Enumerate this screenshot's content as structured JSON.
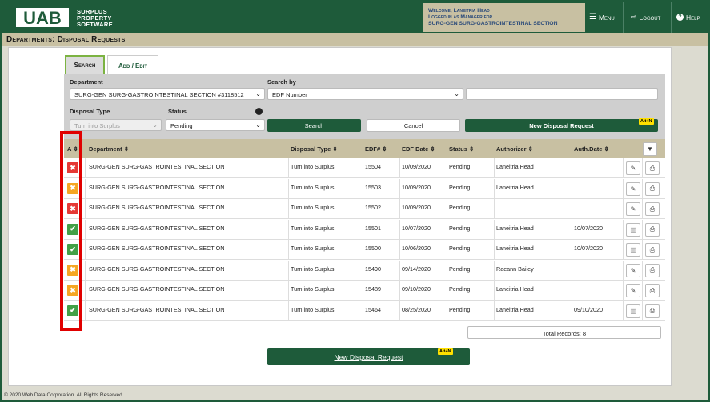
{
  "header": {
    "logo_text": "UAB",
    "app_name_lines": [
      "Surplus",
      "Property",
      "Software"
    ],
    "welcome_lines": [
      "Welcome, Laneitria Head",
      "Logged in as Manager for",
      "SURG-GEN SURG-GASTROINTESTINAL SECTION"
    ],
    "menu_label": "Menu",
    "logout_label": "Logout",
    "help_label": "Help"
  },
  "page_title": "Departments: Disposal Requests",
  "tabs": [
    {
      "label": "Search",
      "active": true
    },
    {
      "label": "Add / Edit",
      "active": false
    }
  ],
  "search": {
    "department_label": "Department",
    "department_value": "SURG-GEN SURG-GASTROINTESTINAL SECTION #3118512",
    "search_by_label": "Search by",
    "search_by_value": "EDF Number",
    "search_text_value": "",
    "disposal_type_label": "Disposal Type",
    "disposal_type_value": "Turn into Surplus",
    "status_label": "Status",
    "status_value": "Pending",
    "search_button": "Search",
    "cancel_button": "Cancel",
    "new_request_button": "New Disposal Request",
    "shortcut": "Alt+N"
  },
  "table": {
    "columns": [
      "A",
      "Department",
      "Disposal Type",
      "EDF#",
      "EDF Date",
      "Status",
      "Authorizer",
      "Auth.Date"
    ],
    "rows": [
      {
        "status_icon": "x",
        "color": "#e53935",
        "department": "SURG-GEN SURG-GASTROINTESTINAL SECTION",
        "type": "Turn into Surplus",
        "edf": "15504",
        "edf_date": "10/09/2020",
        "status": "Pending",
        "authorizer": "Laneitria Head",
        "auth_date": "",
        "action": "pencil"
      },
      {
        "status_icon": "x",
        "color": "#f5a623",
        "department": "SURG-GEN SURG-GASTROINTESTINAL SECTION",
        "type": "Turn into Surplus",
        "edf": "15503",
        "edf_date": "10/09/2020",
        "status": "Pending",
        "authorizer": "Laneitria Head",
        "auth_date": "",
        "action": "pencil"
      },
      {
        "status_icon": "x",
        "color": "#e53935",
        "department": "SURG-GEN SURG-GASTROINTESTINAL SECTION",
        "type": "Turn into Surplus",
        "edf": "15502",
        "edf_date": "10/09/2020",
        "status": "Pending",
        "authorizer": "",
        "auth_date": "",
        "action": "pencil"
      },
      {
        "status_icon": "check",
        "color": "#43a047",
        "department": "SURG-GEN SURG-GASTROINTESTINAL SECTION",
        "type": "Turn into Surplus",
        "edf": "15501",
        "edf_date": "10/07/2020",
        "status": "Pending",
        "authorizer": "Laneitria Head",
        "auth_date": "10/07/2020",
        "action": "barcode"
      },
      {
        "status_icon": "check",
        "color": "#43a047",
        "department": "SURG-GEN SURG-GASTROINTESTINAL SECTION",
        "type": "Turn into Surplus",
        "edf": "15500",
        "edf_date": "10/06/2020",
        "status": "Pending",
        "authorizer": "Laneitria Head",
        "auth_date": "10/07/2020",
        "action": "barcode"
      },
      {
        "status_icon": "x",
        "color": "#f5a623",
        "department": "SURG-GEN SURG-GASTROINTESTINAL SECTION",
        "type": "Turn into Surplus",
        "edf": "15490",
        "edf_date": "09/14/2020",
        "status": "Pending",
        "authorizer": "Raeann Bailey",
        "auth_date": "",
        "action": "pencil"
      },
      {
        "status_icon": "x",
        "color": "#f5a623",
        "department": "SURG-GEN SURG-GASTROINTESTINAL SECTION",
        "type": "Turn into Surplus",
        "edf": "15489",
        "edf_date": "09/10/2020",
        "status": "Pending",
        "authorizer": "Laneitria Head",
        "auth_date": "",
        "action": "pencil"
      },
      {
        "status_icon": "check",
        "color": "#43a047",
        "department": "SURG-GEN SURG-GASTROINTESTINAL SECTION",
        "type": "Turn into Surplus",
        "edf": "15464",
        "edf_date": "08/25/2020",
        "status": "Pending",
        "authorizer": "Laneitria Head",
        "auth_date": "09/10/2020",
        "action": "barcode"
      }
    ],
    "total_records": "Total Records: 8"
  },
  "bottom_button": "New Disposal Request",
  "bottom_shortcut": "Alt+N",
  "copyright": "© 2020 Web Data Corporation. All Rights Reserved."
}
